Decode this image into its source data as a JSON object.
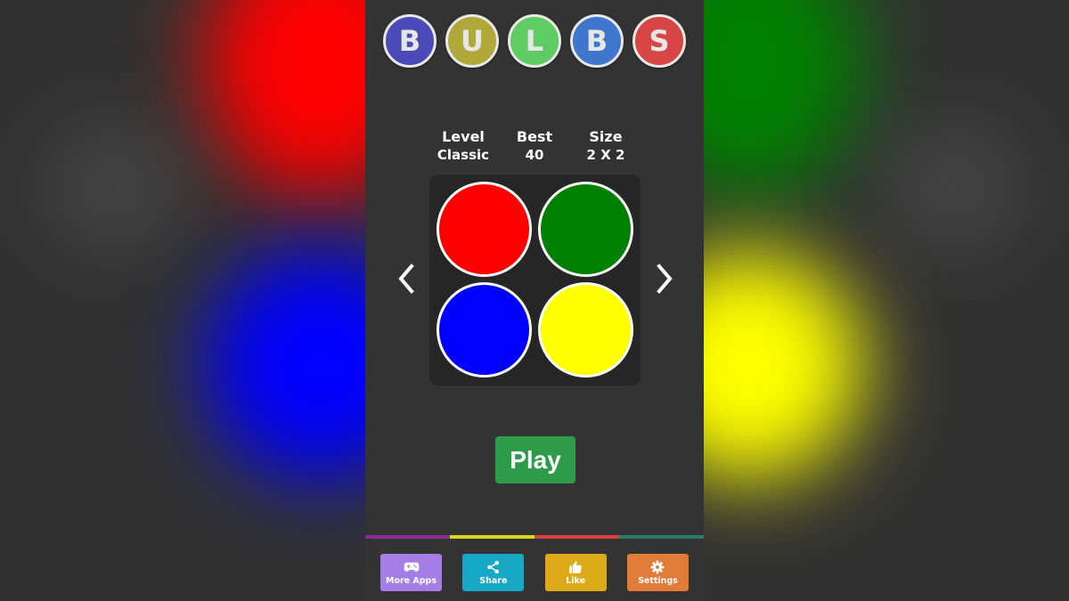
{
  "title": {
    "letters": [
      {
        "char": "B",
        "color": "#4a4ab8"
      },
      {
        "char": "U",
        "color": "#b0a93a"
      },
      {
        "char": "L",
        "color": "#5fcc63"
      },
      {
        "char": "B",
        "color": "#3f77cf"
      },
      {
        "char": "S",
        "color": "#d84545"
      }
    ]
  },
  "stats": {
    "level_label": "Level",
    "level_value": "Classic",
    "best_label": "Best",
    "best_value": "40",
    "size_label": "Size",
    "size_value": "2 X 2"
  },
  "board": {
    "cells": [
      {
        "color": "#ff0000"
      },
      {
        "color": "#008000"
      },
      {
        "color": "#0000ff"
      },
      {
        "color": "#ffff00"
      }
    ]
  },
  "nav": {
    "prev_icon": "chevron-left-icon",
    "next_icon": "chevron-right-icon"
  },
  "play_label": "Play",
  "stripe_colors": [
    "#8e2b8e",
    "#d8d81c",
    "#d94040",
    "#2b7a6a"
  ],
  "bottom_buttons": [
    {
      "label": "More Apps",
      "icon": "gamepad-icon",
      "color": "#a47de6"
    },
    {
      "label": "Share",
      "icon": "share-icon",
      "color": "#17a8c6"
    },
    {
      "label": "Like",
      "icon": "thumbs-up-icon",
      "color": "#dcab17"
    },
    {
      "label": "Settings",
      "icon": "gear-icon",
      "color": "#e07b38"
    }
  ]
}
